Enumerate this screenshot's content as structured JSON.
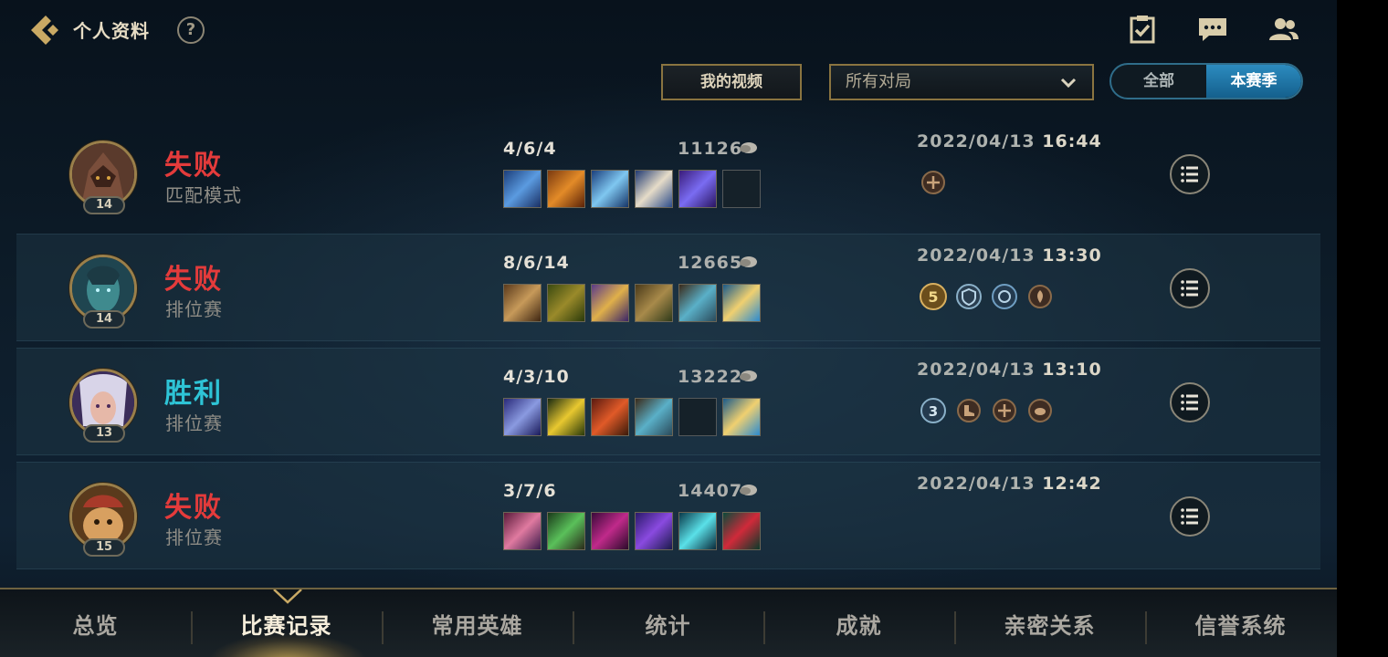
{
  "header": {
    "title": "个人资料",
    "help_label": "?",
    "icons": [
      "back-arrow-icon",
      "help-icon",
      "clipboard-check-icon",
      "chat-icon",
      "friends-icon"
    ]
  },
  "filters": {
    "my_videos_label": "我的视频",
    "match_filter_value": "所有对局",
    "scope_all_label": "全部",
    "scope_season_label": "本赛季",
    "scope_selected": "本赛季"
  },
  "matches": [
    {
      "level": "14",
      "result": "失败",
      "result_type": "loss",
      "mode": "匹配模式",
      "kda": "4/6/4",
      "gold": "11126",
      "date": "2022/04/13",
      "time": "16:44",
      "badges": [
        "cross-medal-icon"
      ]
    },
    {
      "level": "14",
      "result": "失败",
      "result_type": "loss",
      "mode": "排位赛",
      "kda": "8/6/14",
      "gold": "12665",
      "date": "2022/04/13",
      "time": "13:30",
      "badges": [
        "penta-5-medal-icon",
        "shield-medal-icon",
        "shield-medal-icon",
        "flame-medal-icon"
      ]
    },
    {
      "level": "13",
      "result": "胜利",
      "result_type": "win",
      "mode": "排位赛",
      "kda": "4/3/10",
      "gold": "13222",
      "date": "2022/04/13",
      "time": "13:10",
      "badges": [
        "triple-3-medal-icon",
        "boot-medal-icon",
        "cross-medal-icon",
        "coin-medal-icon"
      ]
    },
    {
      "level": "15",
      "result": "失败",
      "result_type": "loss",
      "mode": "排位赛",
      "kda": "3/7/6",
      "gold": "14407",
      "date": "2022/04/13",
      "time": "12:42",
      "badges": []
    }
  ],
  "tabs": [
    {
      "label": "总览",
      "active": false
    },
    {
      "label": "比赛记录",
      "active": true
    },
    {
      "label": "常用英雄",
      "active": false
    },
    {
      "label": "统计",
      "active": false
    },
    {
      "label": "成就",
      "active": false
    },
    {
      "label": "亲密关系",
      "active": false
    },
    {
      "label": "信誉系统",
      "active": false
    }
  ],
  "colors": {
    "loss": "#e43b3b",
    "win": "#2ec4d6",
    "gold_accent": "#8a7440",
    "season_toggle": "#2c8bbf"
  }
}
